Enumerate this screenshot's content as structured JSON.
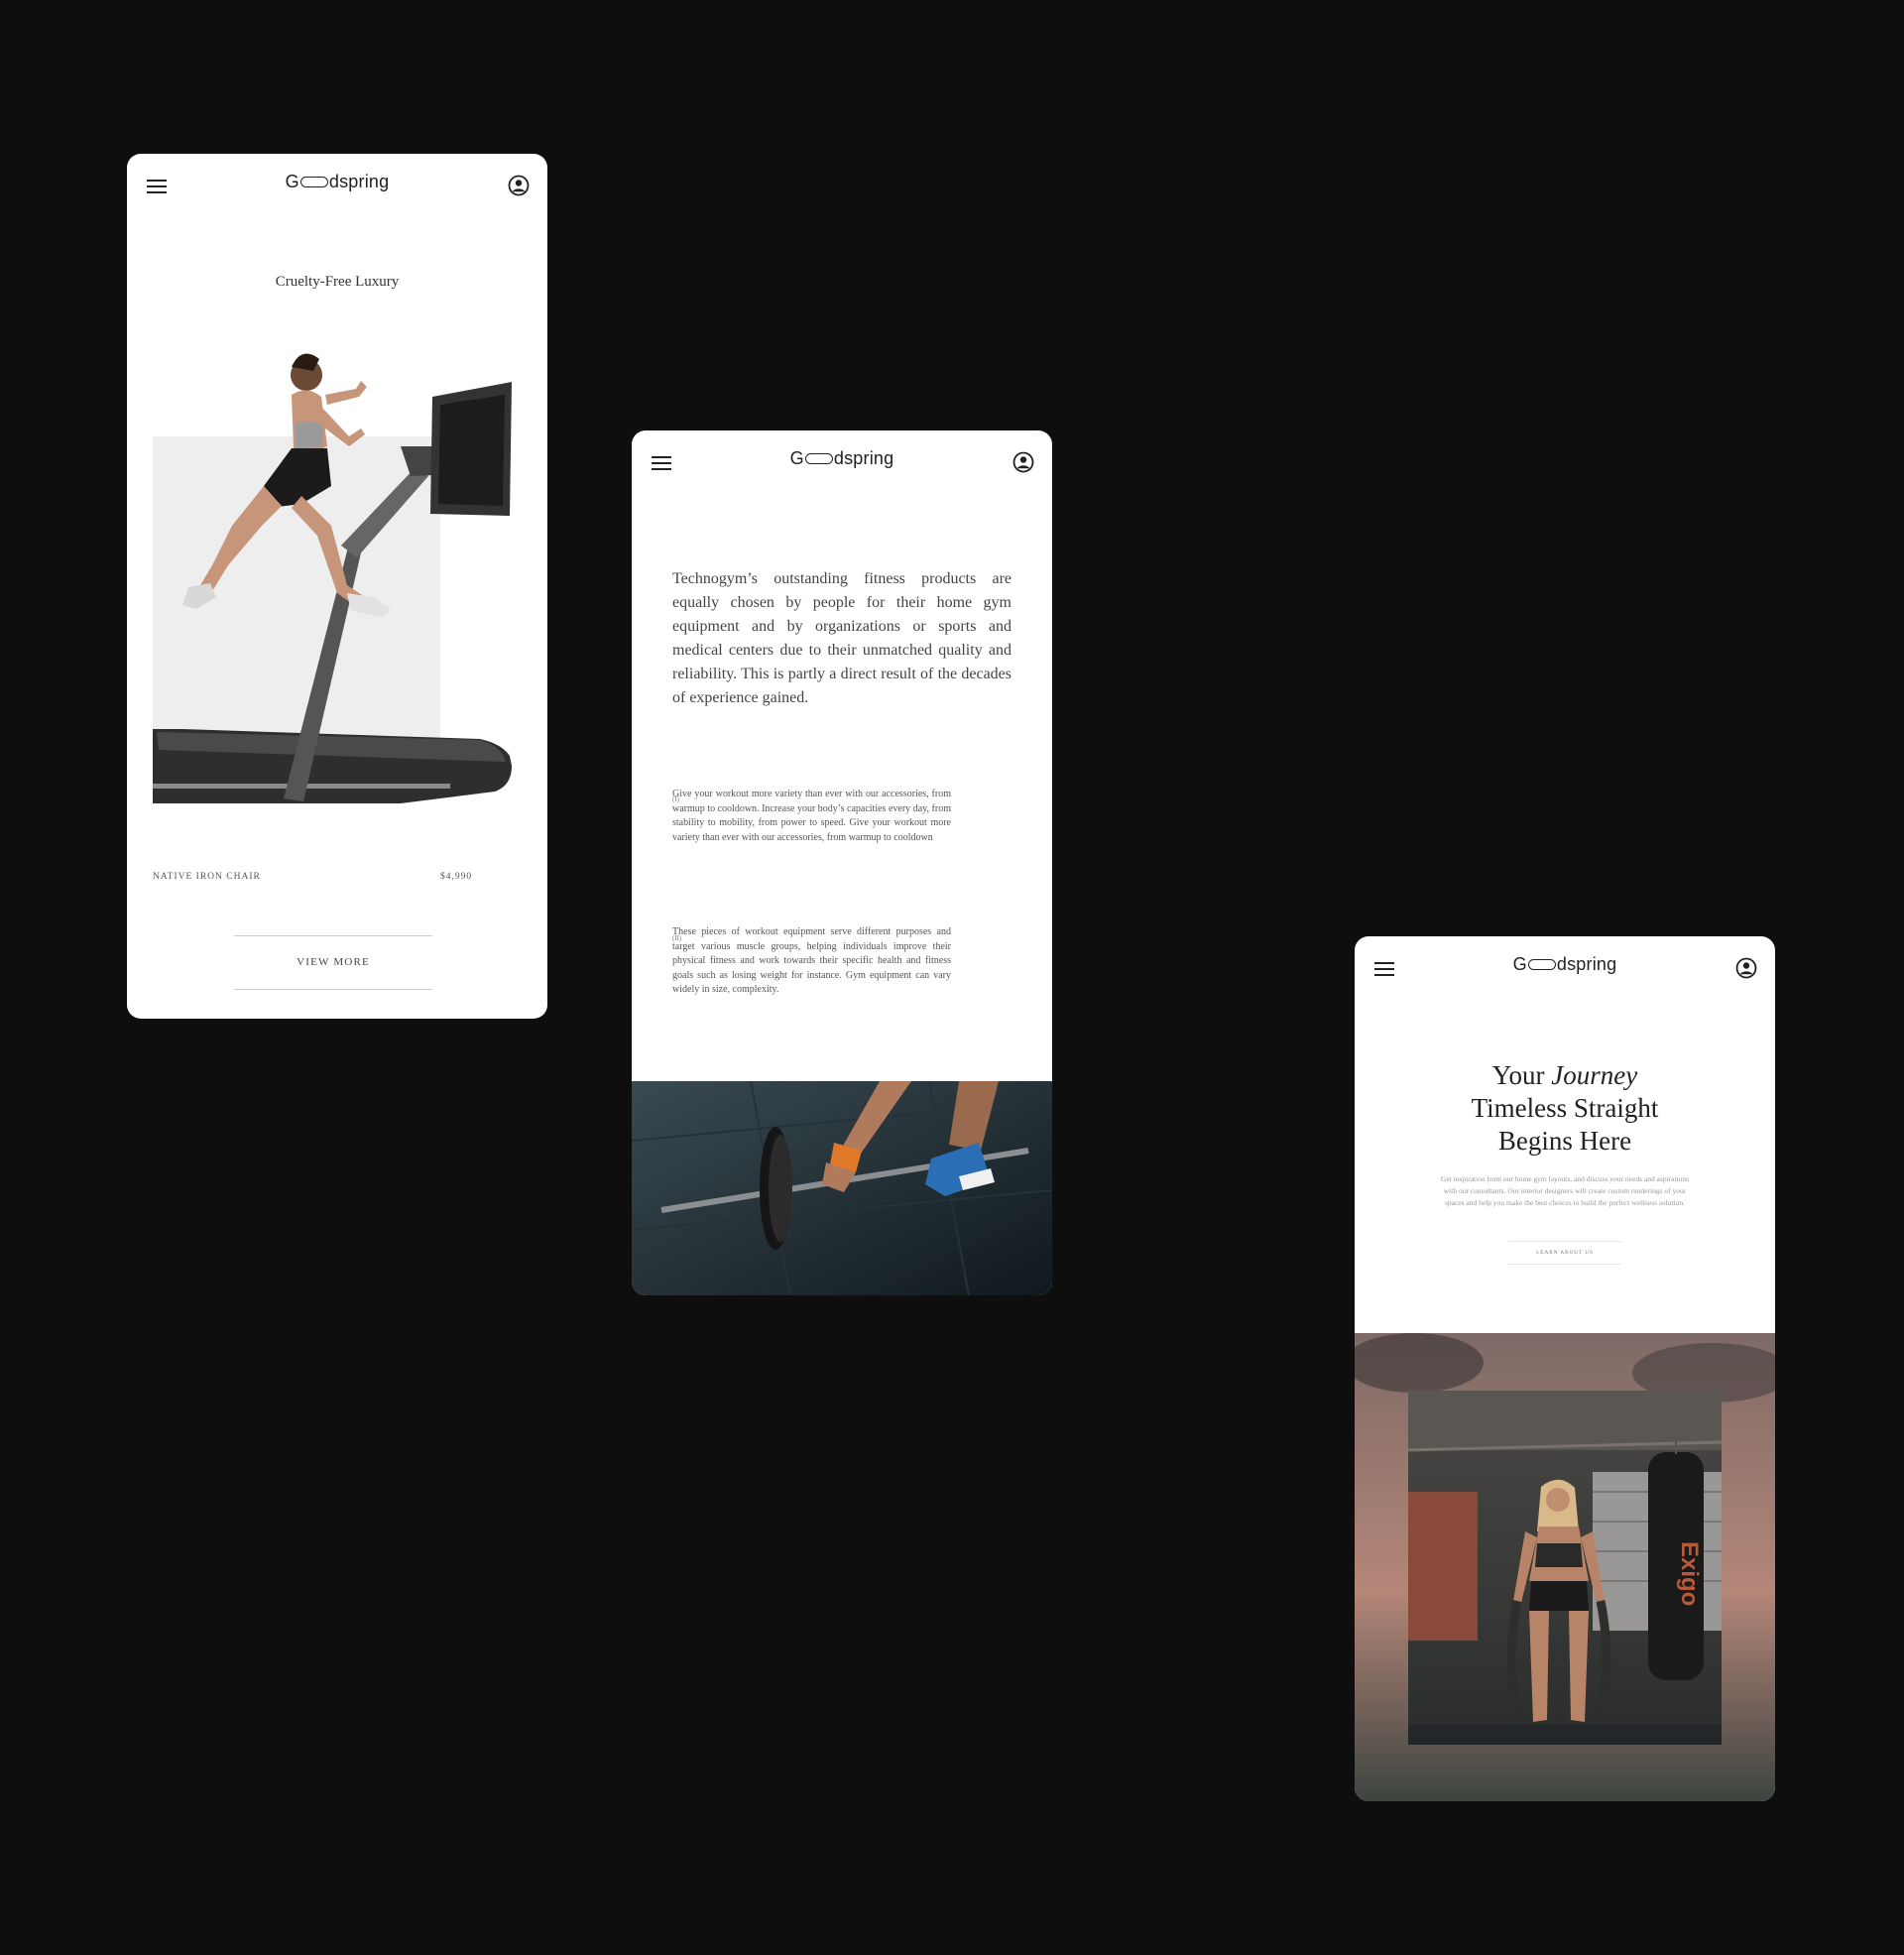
{
  "brand": {
    "logo_start": "G",
    "logo_end": "dspring"
  },
  "screen_product": {
    "title": "Cruelty-Free Luxury",
    "product_name": "NATIVE IRON CHAIR",
    "product_price": "$4,990",
    "view_more_label": "VIEW MORE"
  },
  "screen_about": {
    "lead": "Technogym’s outstanding fitness products are equally chosen by people for their home gym equipment and by organizations or sports and medical centers due to their unmatched quality and reliability. This is partly a direct result of the decades of experience gained.",
    "items": [
      {
        "index": "(I)",
        "text": "Give your workout more variety than ever with our accessories, from warmup to cooldown. Increase your body’s capacities every day, from stability to mobility, from power to speed. Give your workout more variety than ever with our accessories, from warmup to cooldown"
      },
      {
        "index": "(II)",
        "text": "These pieces of workout equipment serve different purposes and target various muscle groups, helping individuals improve their physical fitness and work towards their specific health and fitness goals such as losing weight for instance. Gym equipment can vary widely in size, complexity."
      }
    ]
  },
  "screen_journey": {
    "heading_line1_a": "Your",
    "heading_line1_b": "Journey",
    "heading_line2": "Timeless Straight",
    "heading_line3": "Begins Here",
    "subtext": "Get inspiration from our home gym layouts, and discuss your needs and aspirations with our consultants. Our interior designers will create custom renderings of your spaces and help you make the best choices to build the perfect wellness solution.",
    "cta_label": "LEARN ABOUT US",
    "bag_brand": "Exigo"
  },
  "icons": {
    "menu": "hamburger-menu-icon",
    "account": "user-circle-icon"
  },
  "colors": {
    "canvas": "#0e0e0e",
    "card": "#ffffff",
    "text": "#222222"
  }
}
